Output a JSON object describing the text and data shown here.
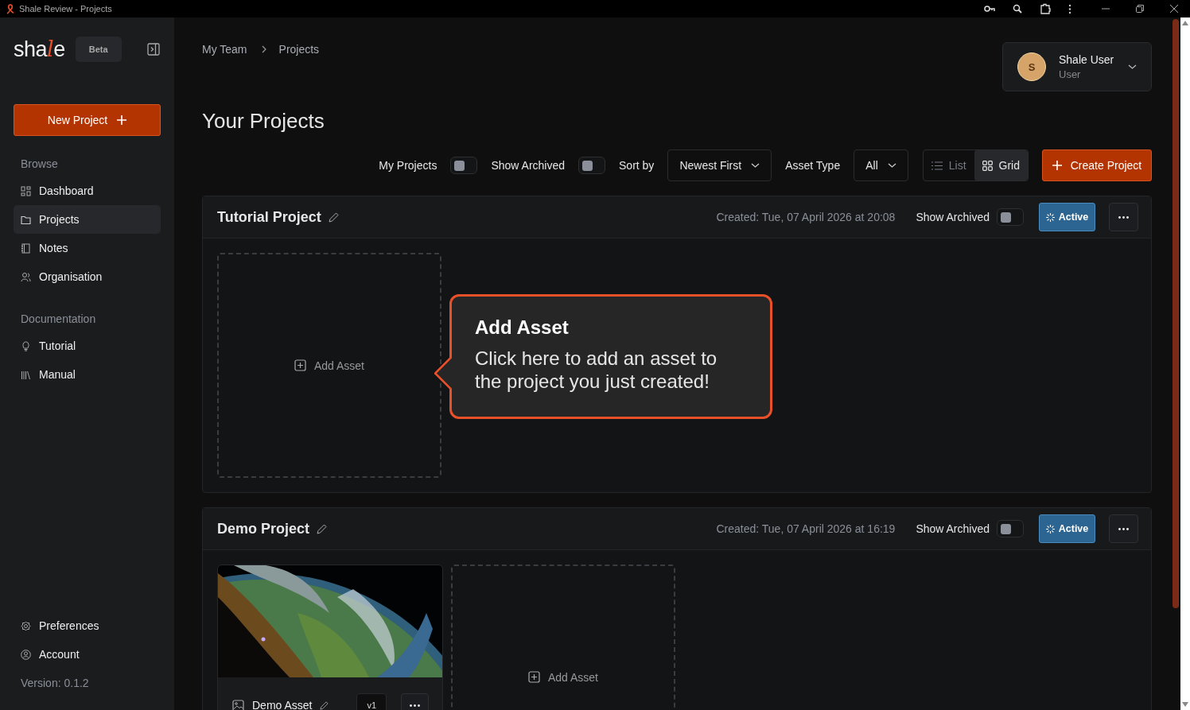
{
  "window": {
    "title": "Shale Review - Projects"
  },
  "sidebar": {
    "logo": {
      "before": "sha",
      "accent": "l",
      "after": "e"
    },
    "badge": "Beta",
    "new_button": "New Project",
    "sections": [
      {
        "title": "Browse",
        "items": [
          {
            "label": "Dashboard",
            "selected": false
          },
          {
            "label": "Projects",
            "selected": true
          },
          {
            "label": "Notes",
            "selected": false
          },
          {
            "label": "Organisation",
            "selected": false
          }
        ]
      },
      {
        "title": "Documentation",
        "items": [
          {
            "label": "Tutorial",
            "selected": false
          },
          {
            "label": "Manual",
            "selected": false
          }
        ]
      }
    ],
    "bottom_items": [
      "Preferences",
      "Account"
    ],
    "version": "Version: 0.1.2"
  },
  "breadcrumb": [
    "My Team",
    "Projects"
  ],
  "user": {
    "initial": "S",
    "name": "Shale User",
    "role": "User"
  },
  "heading": "Your Projects",
  "toolbar": {
    "my_projects": {
      "label": "My Projects",
      "on": false
    },
    "show_archived": {
      "label": "Show Archived",
      "on": false
    },
    "sort": {
      "label": "Sort by",
      "value": "Newest First"
    },
    "asset_type": {
      "label": "Asset Type",
      "value": "All"
    },
    "views": [
      {
        "label": "List",
        "selected": false
      },
      {
        "label": "Grid",
        "selected": true
      }
    ],
    "create": "Create Project"
  },
  "projects": [
    {
      "name": "Tutorial Project",
      "created": "Created: Tue, 07 April 2026 at 20:08",
      "archived_label": "Show Archived",
      "show_archived": false,
      "status": "Active",
      "add_label": "Add Asset",
      "tooltip": {
        "title": "Add Asset",
        "text": "Click here to add an asset to the project you just created!"
      }
    },
    {
      "name": "Demo Project",
      "created": "Created: Tue, 07 April 2026 at 16:19",
      "archived_label": "Show Archived",
      "show_archived": false,
      "status": "Active",
      "assets": [
        {
          "kind": "picture",
          "name": "Demo Asset",
          "version": "v1"
        }
      ],
      "add_label": "Add Asset"
    }
  ]
}
